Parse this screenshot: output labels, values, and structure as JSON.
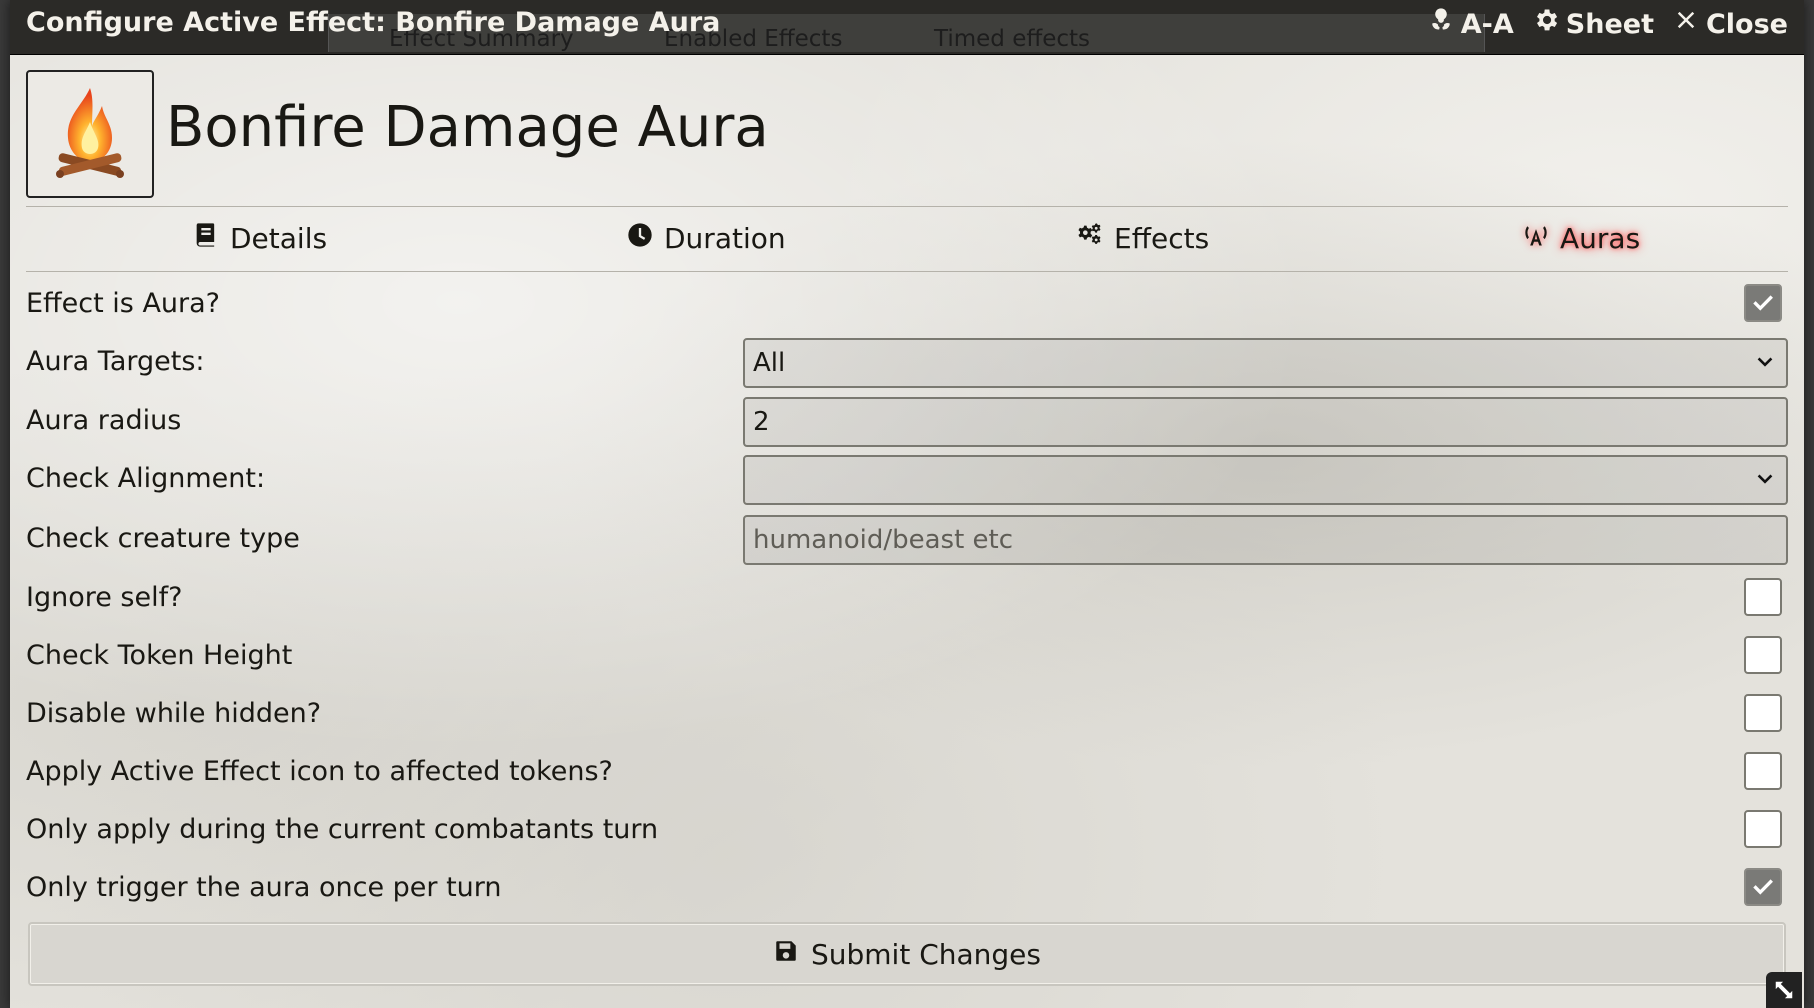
{
  "window": {
    "title": "Configure Active Effect: Bonfire Damage Aura",
    "behind_tabs": [
      "Effect Summary",
      "Enabled Effects",
      "Timed effects"
    ],
    "controls": [
      {
        "label": "A-A",
        "icon": "biohazard-icon"
      },
      {
        "label": "Sheet",
        "icon": "gear-icon"
      },
      {
        "label": "Close",
        "icon": "close-icon"
      }
    ]
  },
  "effect": {
    "name": "Bonfire Damage Aura",
    "image": "bonfire-icon"
  },
  "tabs": [
    {
      "label": "Details",
      "icon": "book-icon",
      "active": false
    },
    {
      "label": "Duration",
      "icon": "clock-icon",
      "active": false
    },
    {
      "label": "Effects",
      "icon": "cogs-icon",
      "active": false
    },
    {
      "label": "Auras",
      "icon": "broadcast-icon",
      "active": true
    }
  ],
  "form": {
    "effect_is_aura": {
      "label": "Effect is Aura?",
      "checked": true
    },
    "aura_targets": {
      "label": "Aura Targets:",
      "value": "All"
    },
    "aura_radius": {
      "label": "Aura radius",
      "value": "2"
    },
    "check_alignment": {
      "label": "Check Alignment:",
      "value": ""
    },
    "check_creature_type": {
      "label": "Check creature type",
      "placeholder": "humanoid/beast etc",
      "value": ""
    },
    "ignore_self": {
      "label": "Ignore self?",
      "checked": false
    },
    "check_token_height": {
      "label": "Check Token Height",
      "checked": false
    },
    "disable_while_hidden": {
      "label": "Disable while hidden?",
      "checked": false
    },
    "apply_icon": {
      "label": "Apply Active Effect icon to affected tokens?",
      "checked": false
    },
    "only_current_turn": {
      "label": "Only apply during the current combatants turn",
      "checked": false
    },
    "once_per_turn": {
      "label": "Only trigger the aura once per turn",
      "checked": true
    }
  },
  "submit": {
    "label": "Submit Changes",
    "icon": "save-icon"
  },
  "colors": {
    "header_bg": "#2b2a27",
    "active_tab_glow": "#ff4b4b",
    "checkbox_checked": "#7a7a77"
  }
}
